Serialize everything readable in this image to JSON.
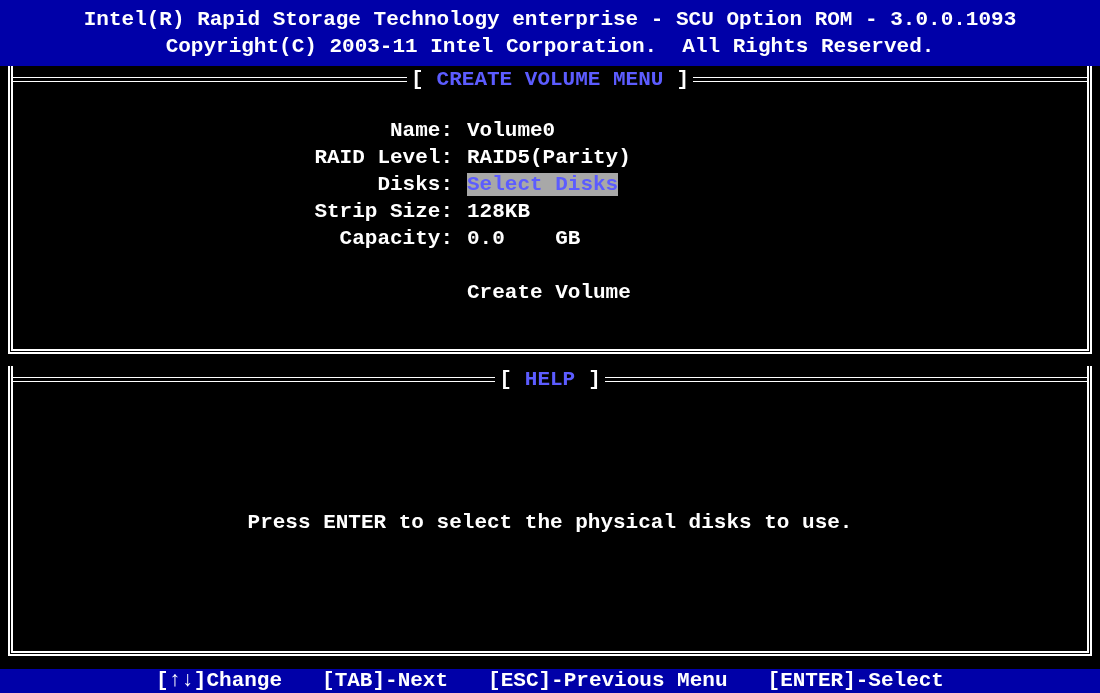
{
  "header": {
    "title": "Intel(R) Rapid Storage Technology enterprise - SCU Option ROM - 3.0.0.1093",
    "copyright": "Copyright(C) 2003-11 Intel Corporation.  All Rights Reserved."
  },
  "create_volume_panel": {
    "bracket_open": "[",
    "title": "CREATE VOLUME MENU",
    "bracket_close": "]",
    "fields": [
      {
        "label": "Name:",
        "value": "Volume0",
        "selected": false
      },
      {
        "label": "RAID Level:",
        "value": "RAID5(Parity)",
        "selected": false
      },
      {
        "label": "Disks:",
        "value": "Select Disks",
        "selected": true
      },
      {
        "label": "Strip Size:",
        "value": "128KB",
        "selected": false
      },
      {
        "label": "Capacity:",
        "value": "0.0    GB",
        "selected": false
      }
    ],
    "action": {
      "label": "Create Volume",
      "selected": false
    }
  },
  "help_panel": {
    "bracket_open": "[",
    "title": "HELP",
    "bracket_close": "]",
    "text": "Press ENTER to select the physical disks to use."
  },
  "footer": {
    "hints": [
      "[↑↓]Change",
      "[TAB]-Next",
      "[ESC]-Previous Menu",
      "[ENTER]-Select"
    ]
  }
}
